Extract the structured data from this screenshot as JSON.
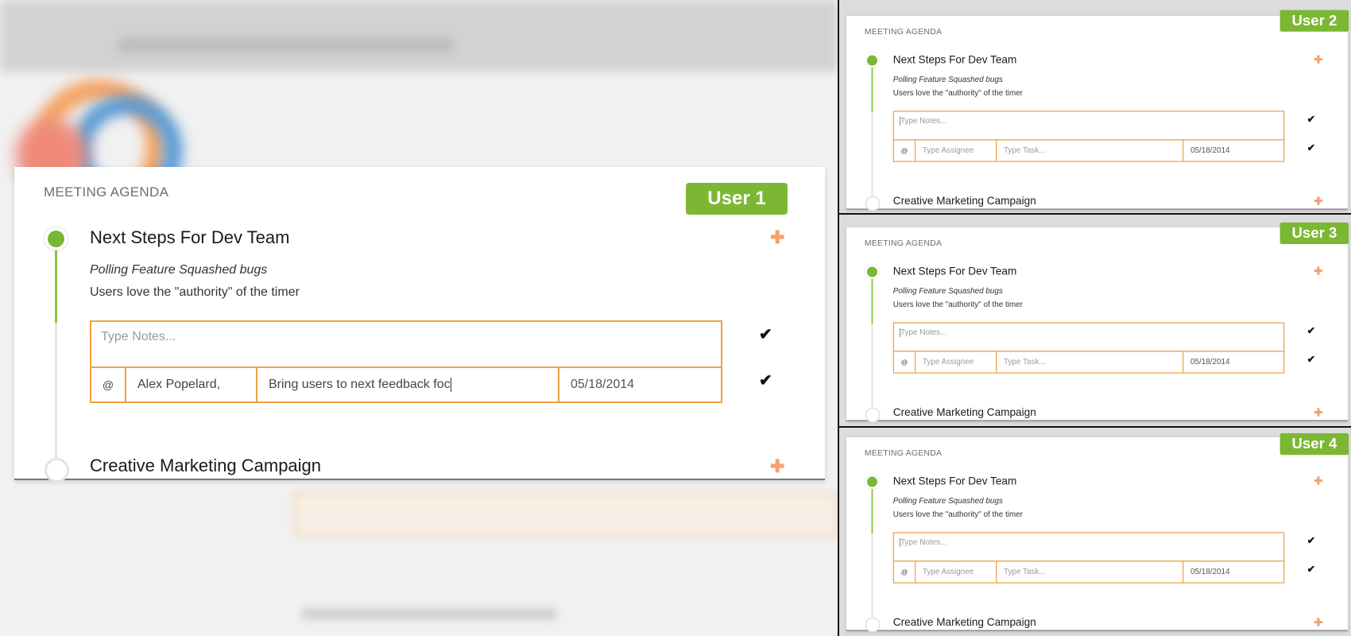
{
  "users": [
    {
      "heading": "MEETING AGENDA",
      "badge": "User 1",
      "item1_title": "Next Steps For Dev Team",
      "note_italic": "Polling Feature Squashed bugs",
      "note_plain": "Users love the \"authority\" of the timer",
      "notes_placeholder": "Type Notes...",
      "at_symbol": "@",
      "assignee": "Alex Popelard,",
      "task": "Bring users to next feedback foc",
      "date": "05/18/2014",
      "item2_title": "Creative Marketing Campaign"
    },
    {
      "heading": "MEETING AGENDA",
      "badge": "User 2",
      "item1_title": "Next Steps For Dev Team",
      "note_italic": "Polling Feature Squashed bugs",
      "note_plain": "Users love the \"authority\" of the timer",
      "notes_placeholder": "Type Notes...",
      "at_symbol": "@",
      "assignee_placeholder": "Type Assignee",
      "task_placeholder": "Type Task...",
      "date": "05/18/2014",
      "item2_title": "Creative Marketing Campaign"
    },
    {
      "heading": "MEETING AGENDA",
      "badge": "User 3",
      "item1_title": "Next Steps For Dev Team",
      "note_italic": "Polling Feature Squashed bugs",
      "note_plain": "Users love the \"authority\" of the timer",
      "notes_placeholder": "Type Notes...",
      "at_symbol": "@",
      "assignee_placeholder": "Type Assignee",
      "task_placeholder": "Type Task...",
      "date": "05/18/2014",
      "item2_title": "Creative Marketing Campaign"
    },
    {
      "heading": "MEETING AGENDA",
      "badge": "User 4",
      "item1_title": "Next Steps For Dev Team",
      "note_italic": "Polling Feature Squashed bugs",
      "note_plain": "Users love the \"authority\" of the timer",
      "notes_placeholder": "Type Notes...",
      "at_symbol": "@",
      "assignee_placeholder": "Type Assignee",
      "task_placeholder": "Type Task...",
      "date": "05/18/2014",
      "item2_title": "Creative Marketing Campaign"
    }
  ],
  "icons": {
    "add": "plus-icon",
    "confirm": "checkmark-icon"
  },
  "colors": {
    "accent_green": "#7cb733",
    "field_border_orange": "#f0a040",
    "plus_orange": "#f5a26c"
  }
}
